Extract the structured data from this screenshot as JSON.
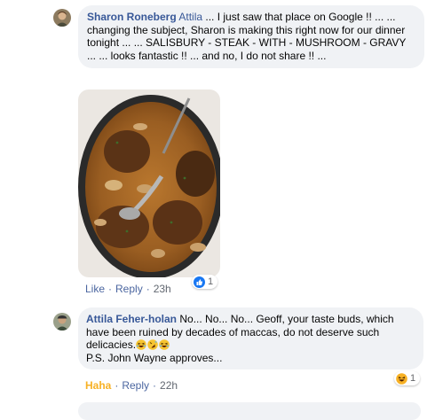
{
  "comment1": {
    "author": "Sharon Roneberg",
    "mention": "Attila",
    "text": " ... I just saw that place on Google !! ... ... changing the subject, Sharon is making this right now for our dinner tonight ... ... SALISBURY - STEAK - WITH - MUSHROOM - GRAVY ... ... looks fantastic !! ... and no, I do not share !! ...",
    "like_label": "Like",
    "reply_label": "Reply",
    "time": "23h",
    "reaction_count": "1",
    "reaction_icon": "like-icon",
    "reaction_color": "#1877f2"
  },
  "comment2": {
    "author": "Attila Feher-holan",
    "text": " No... No... No... Geoff, your taste buds, which have been ruined by decades of maccas, do not deserve such delicacies.",
    "emojis": [
      "laughing-emoji",
      "rofl-emoji",
      "laughing-emoji"
    ],
    "ps": "P.S. John Wayne approves...",
    "haha_label": "Haha",
    "reply_label": "Reply",
    "time": "22h",
    "reaction_count": "1",
    "reaction_icon": "haha-icon",
    "reaction_color": "#f7b125"
  },
  "colors": {
    "bubble": "#f0f2f5",
    "name": "#385898",
    "action": "#4b66a0",
    "haha": "#f7b125"
  }
}
